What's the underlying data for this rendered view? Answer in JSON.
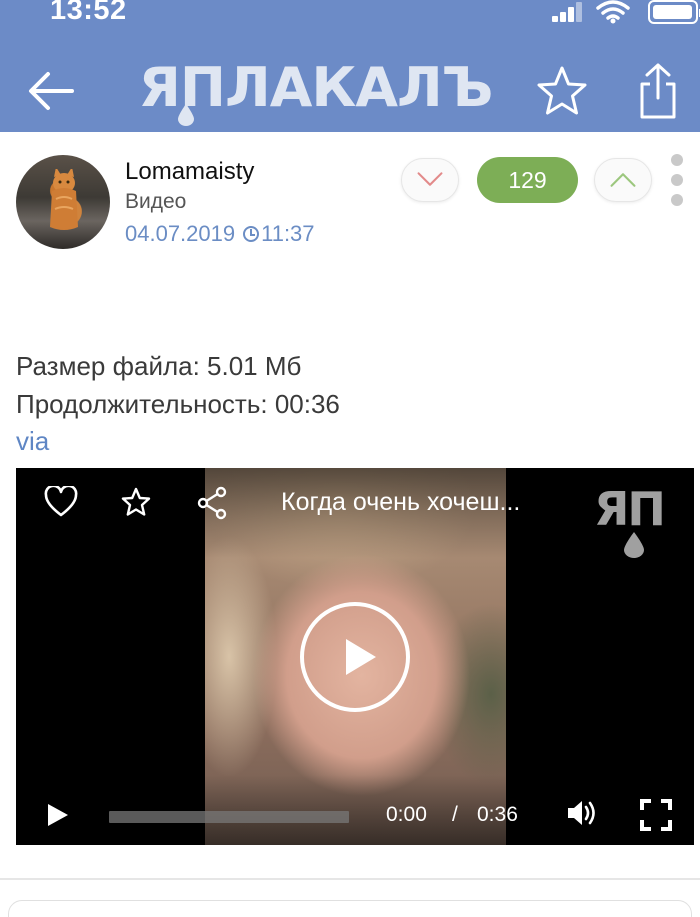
{
  "status_bar": {
    "time": "13:52"
  },
  "header": {
    "logo_text": "ЯПЛАКАЛЪ",
    "back_icon": "arrow-left-icon",
    "favorite_icon": "star-outline-icon",
    "share_icon": "share-upload-icon",
    "background_color": "#6c8bc7"
  },
  "post": {
    "author": "Lomamaisty",
    "category": "Видео",
    "date": "04.07.2019",
    "time": "11:37",
    "rating": "129",
    "rating_color": "#7dae56"
  },
  "file_info": {
    "size_line": "Размер файла: 5.01 Мб",
    "duration_line": "Продолжительность: 00:36",
    "via_label": "via"
  },
  "video": {
    "title": "Когда очень хочеш...",
    "watermark": "ЯП",
    "current_time": "0:00",
    "separator": "/",
    "duration": "0:36",
    "progress": 0
  }
}
